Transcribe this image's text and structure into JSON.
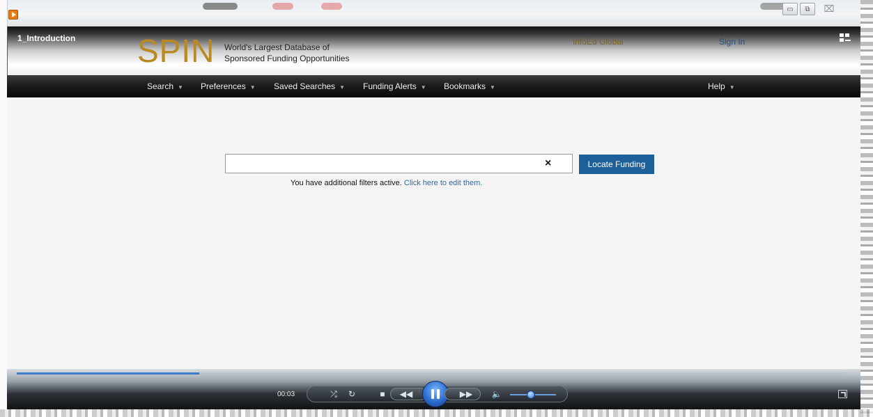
{
  "window": {
    "title": "1_Introduction",
    "minimize_glyph": "▭",
    "restore_glyph": "⧉",
    "close_glyph": "⌧"
  },
  "header": {
    "logo": "SPIN",
    "tagline_line1": "World's Largest Database of",
    "tagline_line2": "Sponsored Funding Opportunities",
    "org": "InfoEd Global",
    "sign_in": "Sign In"
  },
  "nav": {
    "items": [
      {
        "label": "Search"
      },
      {
        "label": "Preferences"
      },
      {
        "label": "Saved Searches"
      },
      {
        "label": "Funding Alerts"
      },
      {
        "label": "Bookmarks"
      }
    ],
    "help": "Help",
    "caret": "▼"
  },
  "search": {
    "value": "",
    "clear_glyph": "×",
    "button": "Locate Funding",
    "note_text": "You have additional filters active.",
    "note_link": "Click here to edit them."
  },
  "player": {
    "time": "00:03",
    "progress": 0.22,
    "volume": 0.45,
    "icons": [
      "shuffle-icon",
      "repeat-icon",
      "stop-icon",
      "rewind-icon",
      "pause-icon",
      "fast-forward-icon",
      "volume-icon",
      "fullscreen-icon"
    ]
  },
  "colors": {
    "logo": "#b98a24",
    "accent": "#1d5f99",
    "link": "#2a6aa8"
  }
}
